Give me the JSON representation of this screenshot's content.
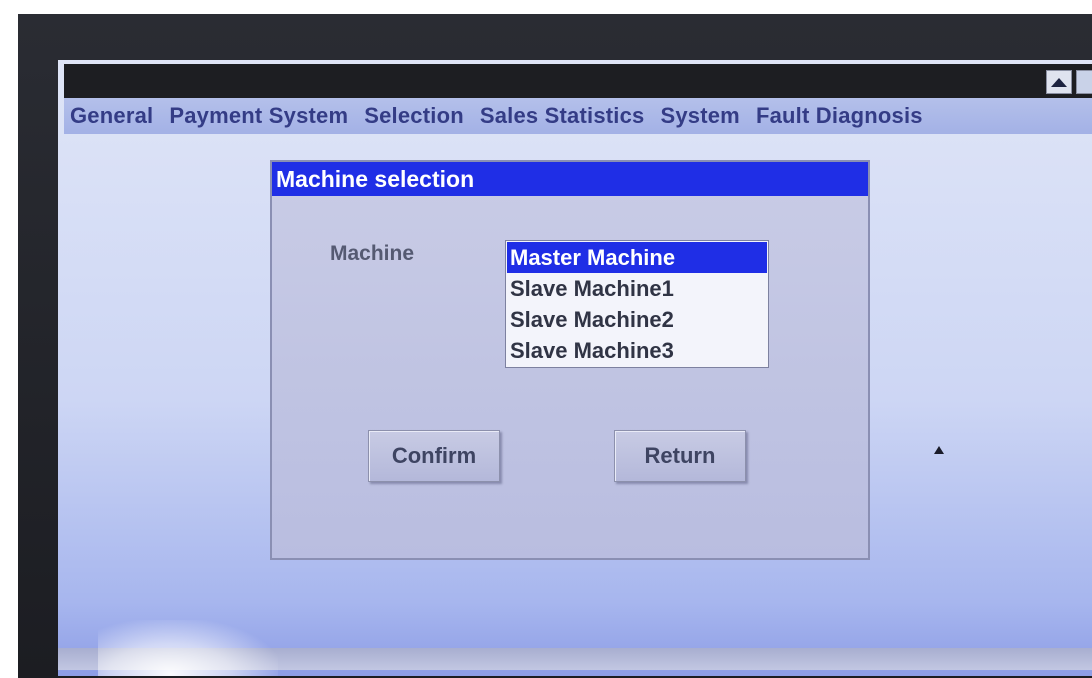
{
  "menu": {
    "items": [
      "General",
      "Payment System",
      "Selection",
      "Sales Statistics",
      "System",
      "Fault Diagnosis"
    ]
  },
  "dialog": {
    "title": "Machine selection",
    "machine_label": "Machine",
    "machine_options": [
      "Master Machine",
      "Slave Machine1",
      "Slave Machine2",
      "Slave Machine3"
    ],
    "selected_option": "Master Machine",
    "confirm_label": "Confirm",
    "return_label": "Return"
  },
  "colors": {
    "selection_blue": "#1f2ee6",
    "menu_text": "#343c86",
    "dialog_background": "#c4c7e3"
  },
  "icons": {
    "scroll_up": "triangle-up-icon"
  }
}
